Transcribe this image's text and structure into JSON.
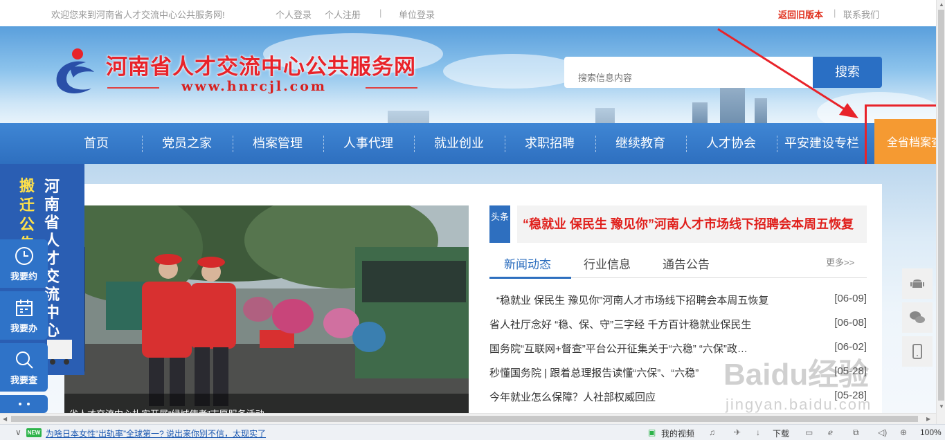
{
  "topbar": {
    "welcome": "欢迎您来到河南省人才交流中心公共服务网!",
    "personal_login": "个人登录",
    "personal_register": "个人注册",
    "unit_login": "单位登录",
    "old_version": "返回旧版本",
    "contact": "联系我们",
    "separator": "|"
  },
  "site": {
    "title": "河南省人才交流中心公共服务网",
    "url": "www.hnrcjl.com"
  },
  "search": {
    "placeholder": "搜索信息内容",
    "button": "搜索"
  },
  "nav": {
    "items": [
      "首页",
      "党员之家",
      "档案管理",
      "人事代理",
      "就业创业",
      "求职招聘",
      "继续教育",
      "人才协会",
      "平安建设专栏"
    ],
    "highlight": "全省档案查"
  },
  "left_banner": {
    "yellow_text": "搬迁公告",
    "white_text": "河南省人才交流中心"
  },
  "side_buttons": [
    {
      "label": "我要约",
      "icon": "clock-icon"
    },
    {
      "label": "我要办",
      "icon": "calendar-icon"
    },
    {
      "label": "我要查",
      "icon": "search-icon"
    }
  ],
  "photo": {
    "caption": "省人才交流中心扎实开展“绿城使者”志愿服务活动"
  },
  "headline": {
    "tag": "头条",
    "text": "“稳就业 保民生 豫见你”河南人才市场线下招聘会本周五恢复"
  },
  "tabs": {
    "items": [
      "新闻动态",
      "行业信息",
      "通告公告"
    ],
    "active": "新闻动态",
    "more": "更多>>"
  },
  "news": [
    {
      "title": "“稳就业 保民生 豫见你”河南人才市场线下招聘会本周五恢复",
      "date": "[06-09]"
    },
    {
      "title": "省人社厅念好 “稳、保、守”三字经 千方百计稳就业保民生",
      "date": "[06-08]"
    },
    {
      "title": "国务院“互联网+督查”平台公开征集关于“六稳” “六保”政…",
      "date": "[06-02]"
    },
    {
      "title": "秒懂国务院 | 跟着总理报告读懂“六保”、“六稳”",
      "date": "[05-28]"
    },
    {
      "title": "今年就业怎么保障？人社部权威回应",
      "date": "[05-28]"
    }
  ],
  "right_icons": [
    "android-icon",
    "wechat-icon",
    "mobile-icon"
  ],
  "watermark": {
    "main": "Baidu经验",
    "sub": "jingyan.baidu.com"
  },
  "statusbar": {
    "badge": "NEW",
    "ticker": "为啥日本女性“出轨率”全球第一? 说出来你别不信，太现实了",
    "video": "我的视频",
    "download": "下载",
    "zoom": "100%"
  },
  "colors": {
    "brand_blue": "#2e6fbf",
    "title_red": "#e8232a",
    "nav_orange": "#f59a32"
  }
}
